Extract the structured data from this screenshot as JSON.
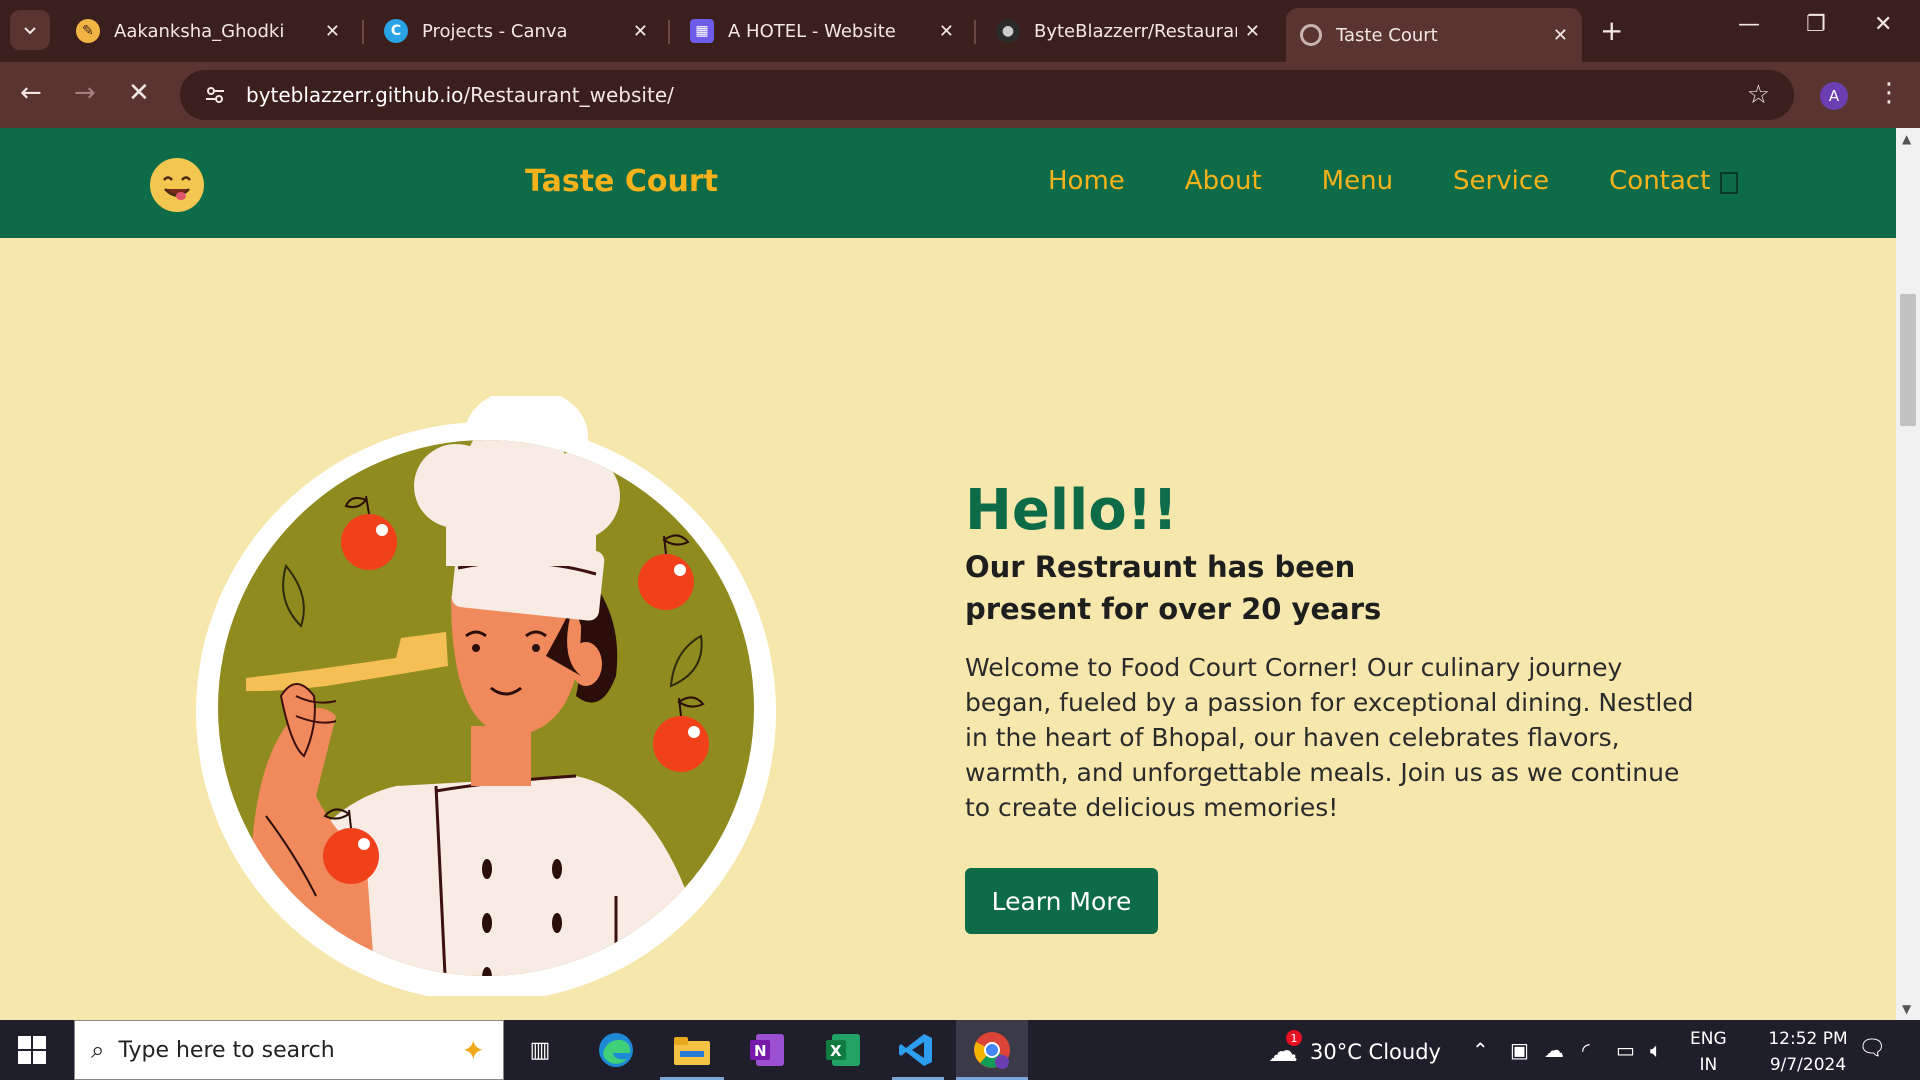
{
  "browser": {
    "tabs": [
      {
        "label": "Aakanksha_Ghodki",
        "favicon": "pen-nib-icon",
        "color": "#f2b544"
      },
      {
        "label": "Projects - Canva",
        "favicon": "canva-icon",
        "color": "#2aa2e6"
      },
      {
        "label": "A HOTEL - Website",
        "favicon": "calendar-icon",
        "color": "#6c5ce7"
      },
      {
        "label": "ByteBlazzerr/Restaurant_",
        "favicon": "github-icon",
        "color": "#2b2b2b"
      },
      {
        "label": "Taste Court",
        "favicon": "loading-icon",
        "color": "#c9b2b0",
        "active": true
      }
    ],
    "url_host": "byteblazzerr.github.io",
    "url_path": "/Restaurant_website/",
    "profile_initial": "A"
  },
  "site": {
    "brand": "Taste Court",
    "nav": [
      "Home",
      "About",
      "Menu",
      "Service",
      "Contact"
    ],
    "colors": {
      "nav_bg": "#0e6b48",
      "accent": "#f6b21a",
      "page_bg": "#f6e8ad"
    }
  },
  "hero": {
    "heading": "Hello!!",
    "subheading": "Our Restraunt has been present for over 20 years",
    "paragraph": "Welcome to Food Court Corner! Our culinary journey began, fueled by a passion for exceptional dining. Nestled in the heart of Bhopal, our haven celebrates flavors, warmth, and unforgettable meals. Join us as we continue to create delicious memories!",
    "button": "Learn More"
  },
  "taskbar": {
    "search_placeholder": "Type here to search",
    "weather": "30°C  Cloudy",
    "weather_badge": "1",
    "lang_top": "ENG",
    "lang_bottom": "IN",
    "time": "12:52 PM",
    "date": "9/7/2024"
  }
}
